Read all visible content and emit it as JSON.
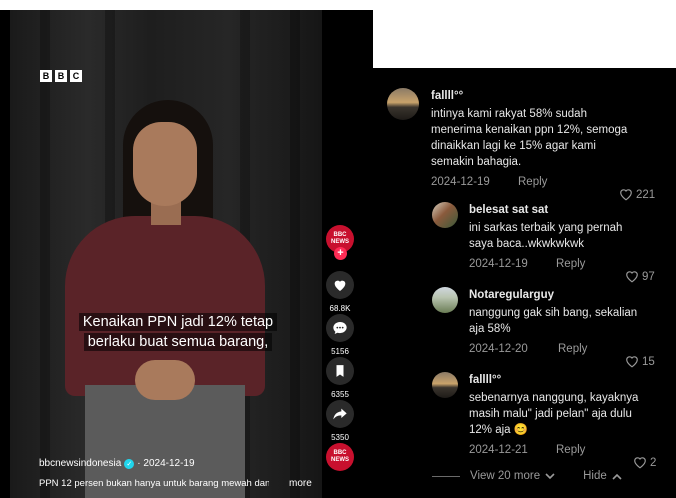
{
  "video": {
    "logo_letters": [
      "B",
      "B",
      "C"
    ],
    "caption": "Kenaikan PPN jadi 12% tetap berlaku buat semua barang,",
    "handle": "bbcnewsindonesia",
    "date": "· 2024-12-19",
    "description": "PPN 12 persen bukan hanya untuk barang mewah dan",
    "more": "more"
  },
  "actions": {
    "avatar_line1": "BBC",
    "avatar_line2": "NEWS",
    "plus": "+",
    "likes": "68.8K",
    "comments": "5156",
    "saves": "6355",
    "shares": "5350"
  },
  "comments": [
    {
      "author": "fallll°°",
      "lines": [
        "intinya kami rakyat 58% sudah",
        "menerima kenaikan ppn 12%, semoga",
        "dinaikkan lagi ke 15% agar kami",
        "semakin bahagia."
      ],
      "date": "2024-12-19",
      "reply": "Reply",
      "likes": "221"
    },
    {
      "author": "belesat sat sat",
      "lines": [
        "ini sarkas terbaik yang pernah",
        "saya baca..wkwkwkwk"
      ],
      "date": "2024-12-19",
      "reply": "Reply",
      "likes": "97"
    },
    {
      "author": "Notaregularguy",
      "lines": [
        "nanggung gak sih bang, sekalian",
        "aja 58%"
      ],
      "date": "2024-12-20",
      "reply": "Reply",
      "likes": "15"
    },
    {
      "author": "fallll°°",
      "lines": [
        "sebenarnya nanggung, kayaknya",
        "masih malu\" jadi pelan\" aja dulu",
        "12% aja 😊"
      ],
      "date": "2024-12-21",
      "reply": "Reply",
      "likes": "2"
    }
  ],
  "footer": {
    "view_more": "View 20 more",
    "hide": "Hide"
  }
}
